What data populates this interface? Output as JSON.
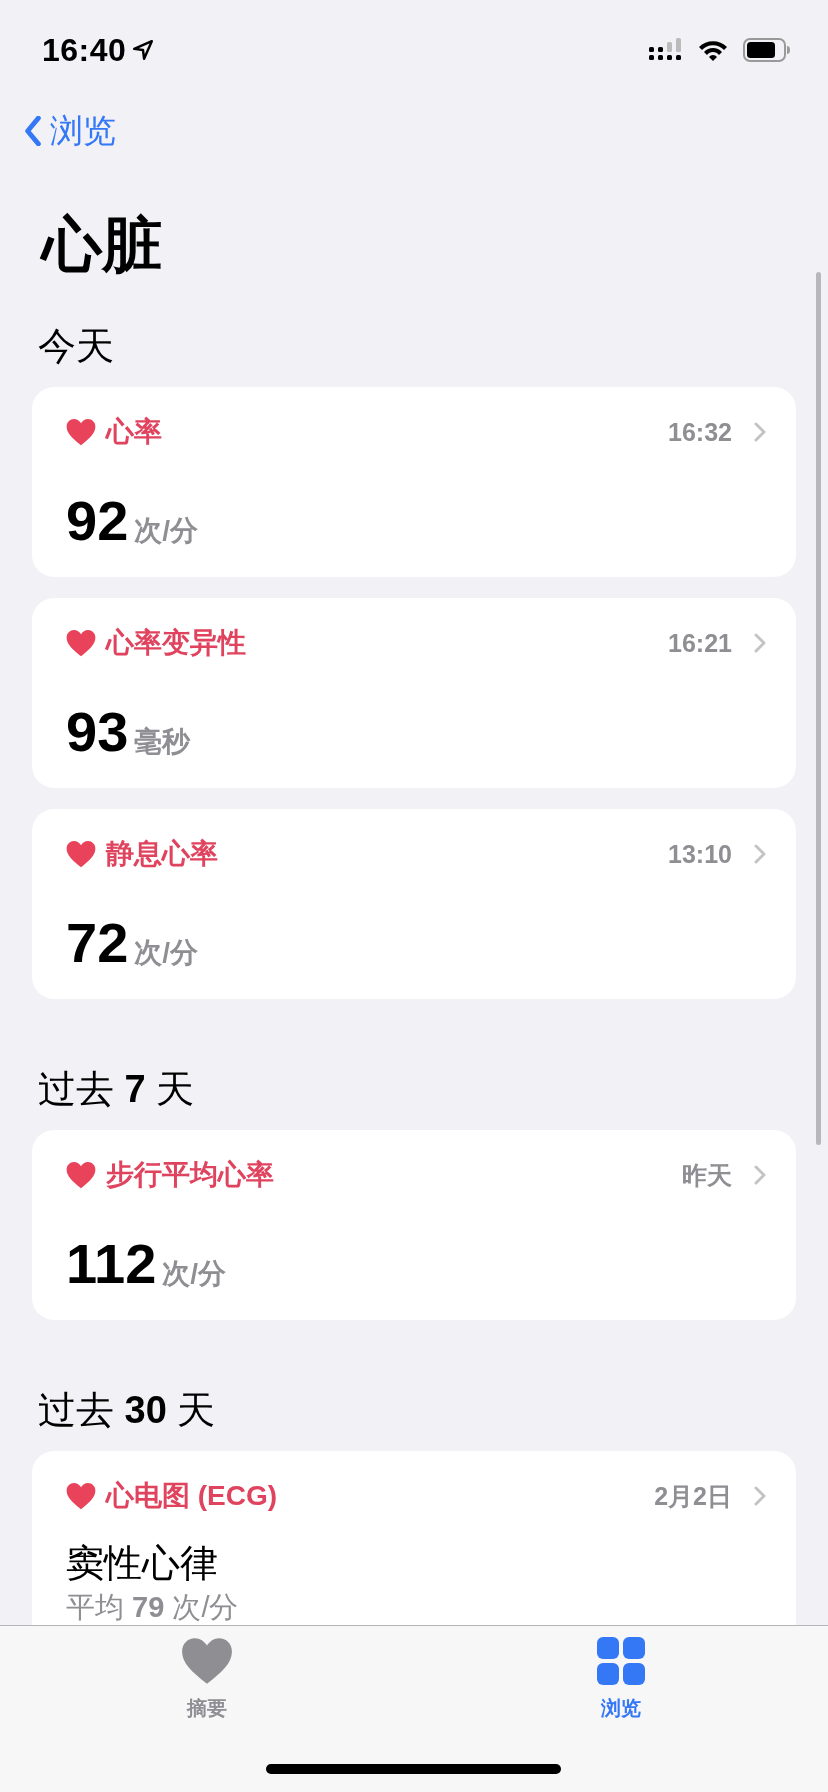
{
  "status_bar": {
    "time": "16:40"
  },
  "nav": {
    "back": "浏览"
  },
  "title": "心脏",
  "sections": [
    {
      "header": "今天",
      "cards": [
        {
          "kind": "metric",
          "title": "心率",
          "time": "16:32",
          "value": "92",
          "unit": "次/分"
        },
        {
          "kind": "metric",
          "title": "心率变异性",
          "time": "16:21",
          "value": "93",
          "unit": "毫秒"
        },
        {
          "kind": "metric",
          "title": "静息心率",
          "time": "13:10",
          "value": "72",
          "unit": "次/分"
        }
      ]
    },
    {
      "header": "过去 **7** 天",
      "cards": [
        {
          "kind": "metric",
          "title": "步行平均心率",
          "time": "昨天",
          "value": "112",
          "unit": "次/分"
        }
      ]
    },
    {
      "header": "过去 **30** 天",
      "cards": [
        {
          "kind": "ecg",
          "title": "心电图 (ECG)",
          "time": "2月2日",
          "result": "窦性心律",
          "detail": "平均 **79** 次/分"
        }
      ]
    }
  ],
  "tab_bar": [
    {
      "label": "摘要",
      "kind": "heart",
      "selected": false
    },
    {
      "label": "浏览",
      "kind": "grid",
      "selected": true
    }
  ]
}
